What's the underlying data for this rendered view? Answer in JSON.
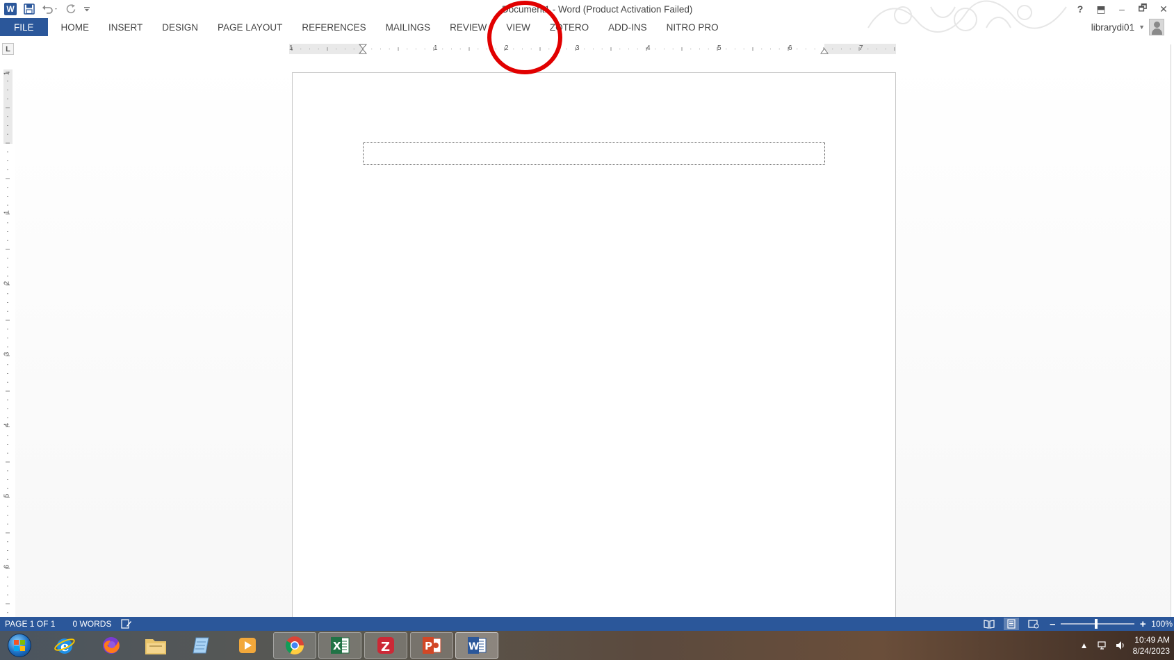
{
  "window": {
    "title": "Document1 - Word (Product Activation Failed)",
    "icons": [
      "word-logo-icon",
      "save-icon",
      "undo-icon",
      "redo-icon",
      "customize-qat-icon"
    ],
    "controls": {
      "help": "?",
      "ribbon_display": "⬒",
      "minimize": "–",
      "restore": "🗗",
      "close": "✕"
    }
  },
  "ribbon": {
    "tabs": [
      {
        "label": "FILE",
        "kind": "file"
      },
      {
        "label": "HOME"
      },
      {
        "label": "INSERT"
      },
      {
        "label": "DESIGN"
      },
      {
        "label": "PAGE LAYOUT"
      },
      {
        "label": "REFERENCES"
      },
      {
        "label": "MAILINGS"
      },
      {
        "label": "REVIEW"
      },
      {
        "label": "VIEW"
      },
      {
        "label": "ZOTERO",
        "highlighted": true
      },
      {
        "label": "ADD-INS"
      },
      {
        "label": "NITRO PRO"
      }
    ],
    "account": {
      "user": "librarydi01"
    }
  },
  "ruler": {
    "tab_selector": "L",
    "horizontal_labels": [
      "1",
      "1",
      "2",
      "3",
      "4",
      "5",
      "6",
      "7"
    ],
    "vertical_labels": [
      "1",
      "1",
      "2",
      "3",
      "4",
      "5",
      "6"
    ]
  },
  "document": {
    "textbox_content": ""
  },
  "status_bar": {
    "page": "PAGE 1 OF 1",
    "words": "0 WORDS",
    "zoom": "100%",
    "zoom_level_percent": 100,
    "views": [
      "read-mode-icon",
      "print-layout-icon",
      "web-layout-icon"
    ]
  },
  "taskbar": {
    "apps": [
      {
        "name": "internet-explorer",
        "glyph": "e"
      },
      {
        "name": "firefox",
        "glyph": ""
      },
      {
        "name": "file-explorer",
        "glyph": ""
      },
      {
        "name": "notepad-app",
        "glyph": ""
      },
      {
        "name": "media-player",
        "glyph": "▶"
      },
      {
        "name": "chrome",
        "glyph": ""
      },
      {
        "name": "excel",
        "glyph": "X"
      },
      {
        "name": "zotero",
        "glyph": "Z"
      },
      {
        "name": "powerpoint",
        "glyph": "P"
      },
      {
        "name": "word",
        "glyph": "W"
      }
    ],
    "time": "10:49 AM",
    "date": "8/24/2023"
  },
  "colors": {
    "word_blue": "#2b579a",
    "highlight_red": "#e10000",
    "excel_green": "#217346",
    "powerpoint_orange": "#d24726",
    "zotero_red": "#cc2936"
  }
}
